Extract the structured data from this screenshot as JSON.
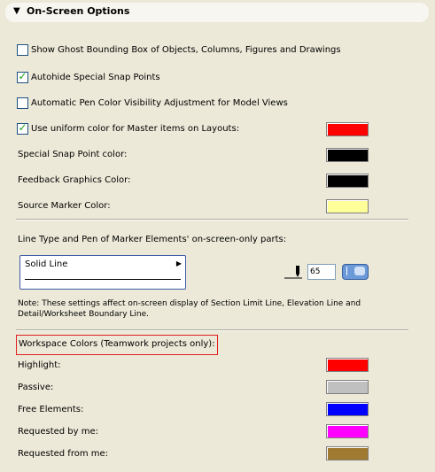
{
  "header": {
    "title": "On-Screen Options"
  },
  "checkboxes": [
    {
      "label": "Show Ghost Bounding Box of Objects, Columns, Figures and Drawings",
      "checked": false
    },
    {
      "label": "Autohide Special Snap Points",
      "checked": true
    },
    {
      "label": "Automatic Pen Color Visibility Adjustment for Model Views",
      "checked": false
    },
    {
      "label": "Use uniform color for Master items on Layouts:",
      "checked": true
    }
  ],
  "colors": {
    "master_items": "#ff0000",
    "snap_point": "#000000",
    "feedback": "#000000",
    "source_marker": "#ffff99"
  },
  "labels": {
    "snap_point": "Special Snap Point color:",
    "feedback": "Feedback Graphics Color:",
    "source_marker": "Source Marker Color:"
  },
  "line_type": {
    "heading": "Line Type and Pen of Marker Elements' on-screen-only parts:",
    "selected": "Solid Line",
    "pen_value": "65"
  },
  "note": "Note: These settings affect on-screen display of Section Limit Line, Elevation Line and Detail/Worksheet Boundary Line.",
  "workspace": {
    "title": "Workspace Colors (Teamwork projects only):",
    "items": [
      {
        "label": "Highlight:",
        "color": "#ff0000"
      },
      {
        "label": "Passive:",
        "color": "#c0c0c0"
      },
      {
        "label": "Free Elements:",
        "color": "#0000ff"
      },
      {
        "label": "Requested by me:",
        "color": "#ff00ff"
      },
      {
        "label": "Requested from me:",
        "color": "#a07a30"
      }
    ]
  },
  "icons": {
    "header_toggle": "triangle-down-icon",
    "pen": "pen-icon"
  }
}
